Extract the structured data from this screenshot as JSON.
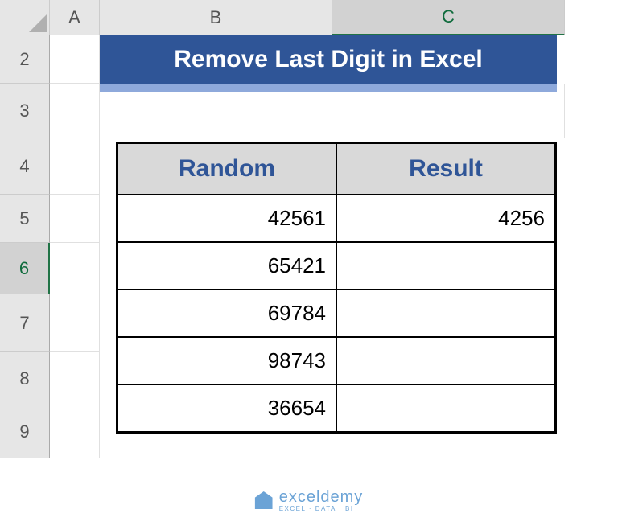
{
  "columns": [
    "A",
    "B",
    "C"
  ],
  "rows": [
    "2",
    "3",
    "4",
    "5",
    "6",
    "7",
    "8",
    "9"
  ],
  "activeColumn": "C",
  "activeRow": "6",
  "title": "Remove Last Digit in Excel",
  "table": {
    "headers": [
      "Random",
      "Result"
    ],
    "data": [
      [
        "42561",
        "4256"
      ],
      [
        "65421",
        ""
      ],
      [
        "69784",
        ""
      ],
      [
        "98743",
        ""
      ],
      [
        "36654",
        ""
      ]
    ]
  },
  "selectedCell": "C6",
  "watermark": {
    "brand": "exceldemy",
    "tagline": "EXCEL · DATA · BI"
  }
}
